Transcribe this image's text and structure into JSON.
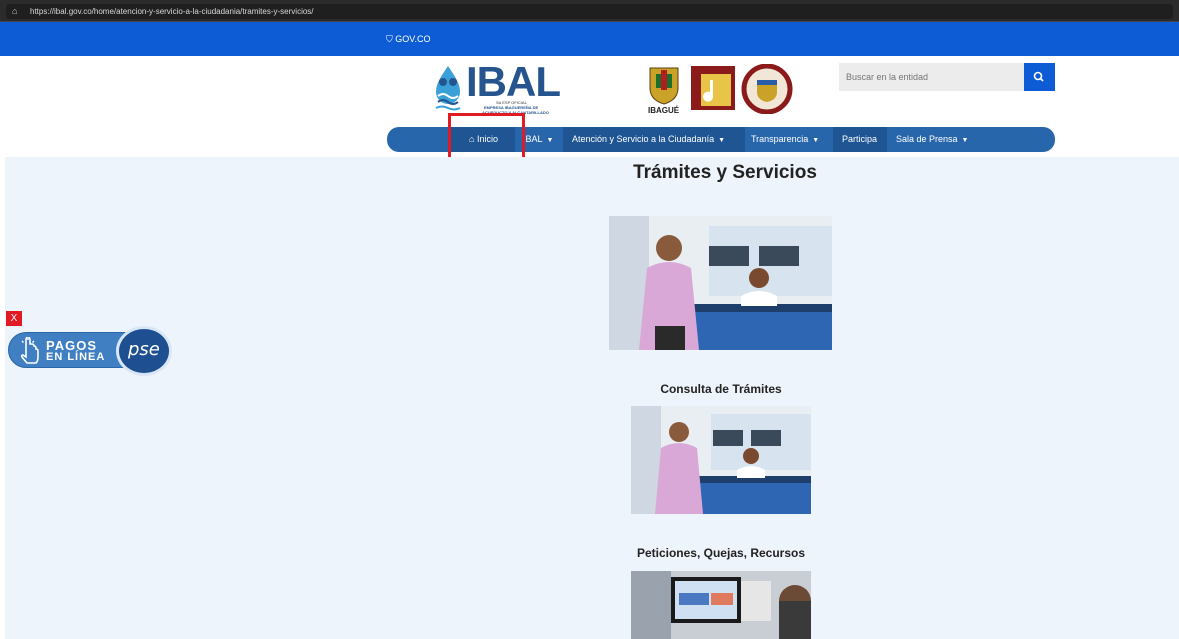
{
  "browser": {
    "url": "https://ibal.gov.co/home/atencion-y-servicio-a-la-ciudadania/tramites-y-servicios/"
  },
  "govbar": {
    "label": "GOV.CO"
  },
  "header": {
    "logo_text": "IBAL",
    "logo_sub1": "SA ESP OFICIAL",
    "logo_sub2": "EMPRESA IBAGUEREÑA DE",
    "logo_sub3": "ACUEDUCTO Y ALCANTARILLADO",
    "city_label": "IBAGUÉ",
    "search_placeholder": "Buscar en la entidad"
  },
  "nav": {
    "items": [
      {
        "label": "Inicio",
        "icon": "home-icon"
      },
      {
        "label": "IBAL",
        "dropdown": true
      },
      {
        "label": "Atención y Servicio a la Ciudadanía",
        "dropdown": true
      },
      {
        "label": "Transparencia",
        "dropdown": true
      },
      {
        "label": "Participa"
      },
      {
        "label": "Sala de Prensa",
        "dropdown": true
      }
    ]
  },
  "main": {
    "title": "Trámites y Servicios",
    "sections": [
      {
        "caption": "Consulta de Trámites"
      },
      {
        "caption": "Peticiones, Quejas, Recursos"
      }
    ]
  },
  "pse_widget": {
    "close_label": "X",
    "line1": "PAGOS",
    "line2": "EN LÍNEA",
    "brand": "pse"
  },
  "colors": {
    "gov_blue": "#0d5cd6",
    "nav_blue": "#2866ab",
    "highlight_red": "#e01b24",
    "page_bg": "#eef4fb"
  }
}
